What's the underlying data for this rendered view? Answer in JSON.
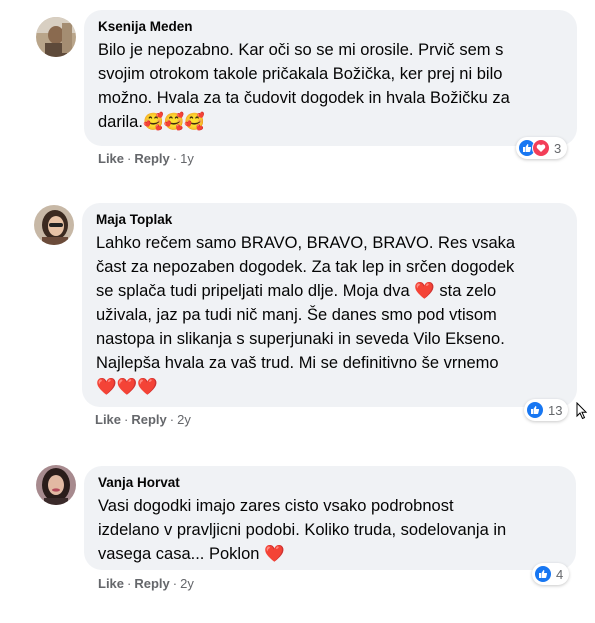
{
  "comments": [
    {
      "author": "Ksenija Meden",
      "text": "Bilo je nepozabno. Kar oči so se mi orosile. Prvič sem s\nsvojim otrokom takole pričakala Božička, ker prej ni bilo\nmožno. Hvala za ta čudovit dogodek in hvala Božičku za\ndarila.🥰🥰🥰",
      "like_label": "Like",
      "reply_label": "Reply",
      "separator": "·",
      "time": "1y",
      "reaction_count": "3",
      "reaction_icons": [
        "like-icon",
        "love-icon"
      ]
    },
    {
      "author": "Maja Toplak",
      "text": "Lahko rečem samo BRAVO, BRAVO, BRAVO. Res vsaka\nčast za nepozaben dogodek. Za tak lep in srčen dogodek\nse splača tudi pripeljati malo dlje. Moja dva ❤️ sta zelo\nuživala, jaz pa tudi nič manj. Še danes smo pod vtisom\nnastopa in slikanja s superjunaki in seveda Vilo Ekseno.\nNajlepša hvala za vaš trud. Mi se definitivno še vrnemo\n❤️❤️❤️",
      "like_label": "Like",
      "reply_label": "Reply",
      "separator": "·",
      "time": "2y",
      "reaction_count": "13",
      "reaction_icons": [
        "like-icon"
      ]
    },
    {
      "author": "Vanja Horvat",
      "text": "Vasi dogodki imajo zares cisto vsako podrobnost\nizdelano v pravljicni podobi. Koliko truda, sodelovanja in\nvasega casa... Poklon ❤️",
      "like_label": "Like",
      "reply_label": "Reply",
      "separator": "·",
      "time": "2y",
      "reaction_count": "4",
      "reaction_icons": [
        "like-icon"
      ]
    }
  ],
  "colors": {
    "bubble": "#f0f2f5",
    "like_blue": "#1877f2",
    "love_red": "#f33e58",
    "meta_gray": "#65676b"
  }
}
